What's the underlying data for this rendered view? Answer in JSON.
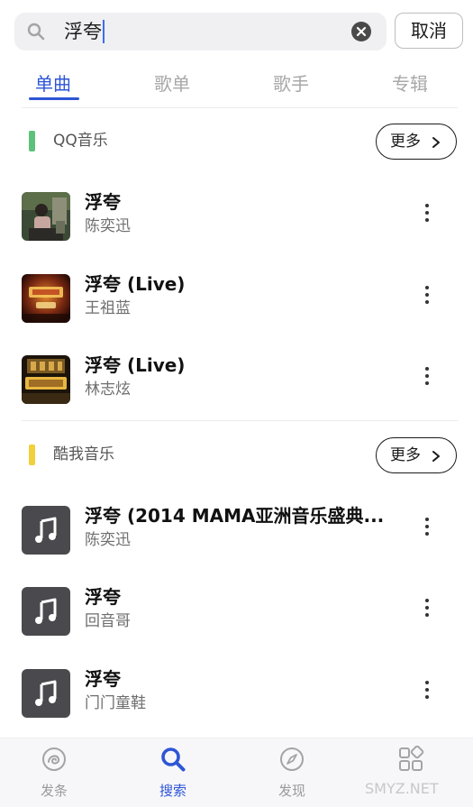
{
  "search": {
    "query": "浮夸",
    "cancel_label": "取消"
  },
  "tabs": [
    {
      "label": "单曲",
      "active": true
    },
    {
      "label": "歌单",
      "active": false
    },
    {
      "label": "歌手",
      "active": false
    },
    {
      "label": "专辑",
      "active": false
    }
  ],
  "sections": [
    {
      "title": "QQ音乐",
      "accent": "#5cc27a",
      "more_label": "更多",
      "songs": [
        {
          "title": "浮夸",
          "artist": "陈奕迅",
          "cover": "album-photo"
        },
        {
          "title": "浮夸 (Live)",
          "artist": "王祖蓝",
          "cover": "stage-poster"
        },
        {
          "title": "浮夸 (Live)",
          "artist": "林志炫",
          "cover": "stage-poster"
        }
      ]
    },
    {
      "title": "酷我音乐",
      "accent": "#f2cf3c",
      "more_label": "更多",
      "songs": [
        {
          "title": "浮夸 (2014 MAMA亚洲音乐盛典...",
          "artist": "陈奕迅",
          "cover": "music-note-icon"
        },
        {
          "title": "浮夸",
          "artist": "回音哥",
          "cover": "music-note-icon"
        },
        {
          "title": "浮夸",
          "artist": "门门童鞋",
          "cover": "music-note-icon"
        }
      ]
    }
  ],
  "nav": [
    {
      "label": "发条",
      "icon": "swirl-icon",
      "active": false
    },
    {
      "label": "搜索",
      "icon": "search-icon",
      "active": true
    },
    {
      "label": "发现",
      "icon": "compass-icon",
      "active": false
    },
    {
      "label": "",
      "icon": "grid-icon",
      "active": false
    }
  ],
  "watermark": "SMYZ.NET",
  "colors": {
    "accent_blue": "#2d55d6",
    "qq_green": "#5cc27a",
    "kuwo_yellow": "#f2cf3c"
  }
}
